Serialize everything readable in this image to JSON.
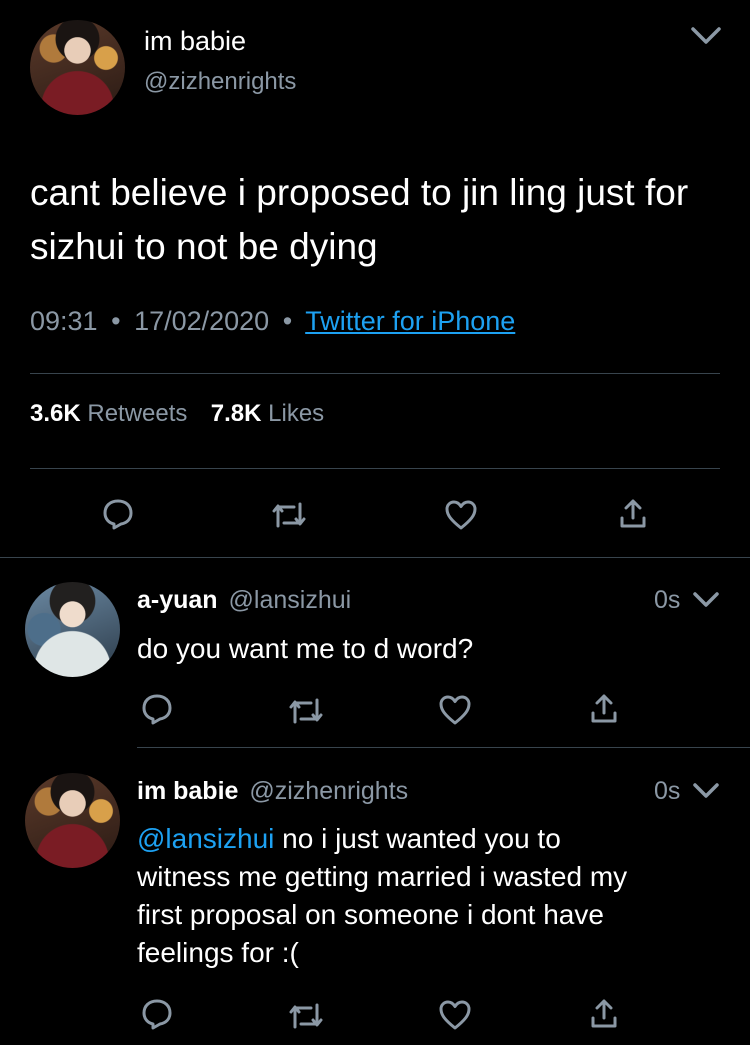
{
  "main_tweet": {
    "display_name": "im babie",
    "handle": "@zizhenrights",
    "text": "cant believe i proposed to jin ling just for sizhui to not be dying",
    "time": "09:31",
    "date": "17/02/2020",
    "source": "Twitter for iPhone",
    "retweets_count": "3.6K",
    "retweets_label": "Retweets",
    "likes_count": "7.8K",
    "likes_label": "Likes"
  },
  "replies": [
    {
      "display_name": "a-yuan",
      "handle": "@lansizhui",
      "time": "0s",
      "text": "do you want me to d word?"
    },
    {
      "display_name": "im babie",
      "handle": "@zizhenrights",
      "time": "0s",
      "mention": "@lansizhui",
      "text_lines": [
        " no i just wanted you to",
        "witness me getting married i wasted my",
        "first proposal on someone i dont have",
        "feelings for :("
      ]
    }
  ],
  "separator": "•",
  "icons": {
    "reply": "speech-bubble-icon",
    "retweet": "retweet-arrows-icon",
    "like": "heart-icon",
    "share": "share-arrow-icon",
    "menu": "chevron-down-icon"
  }
}
